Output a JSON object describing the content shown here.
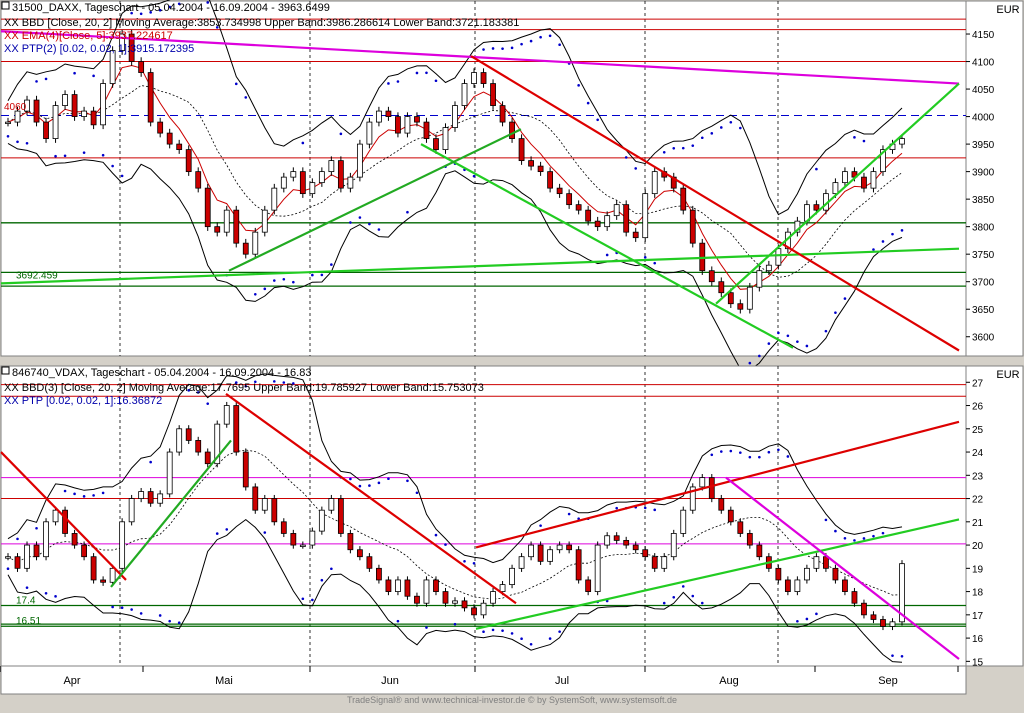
{
  "chart_data": [
    {
      "type": "line",
      "panel": "top",
      "instrument_label": "31500_DAXX, Tageschart - 05.04.2004 - 16.09.2004 - 3963.6499",
      "legend": [
        {
          "text": "XX BBD [Close, 20, 2] Moving Average:3853.734998 Upper Band:3986.286614 Lower Band:3721.183381",
          "color": "#000000"
        },
        {
          "text": "XX EMA(4)[Close, 5]:3937.224617",
          "color": "#cc0000"
        },
        {
          "text": "XX PTP(2) [0.02, 0.02, 1]:3915.172395",
          "color": "#0000aa"
        }
      ],
      "currency": "EUR",
      "ylim": [
        3565,
        4210
      ],
      "y_ticks": [
        "3600",
        "3650",
        "3700",
        "3750",
        "3800",
        "3850",
        "3900",
        "3950",
        "4000",
        "4050",
        "4100",
        "4150"
      ],
      "annotations": [
        "3692.459",
        "4060"
      ],
      "horizontal_levels": [
        {
          "y": 4177,
          "color": "#cc0000"
        },
        {
          "y": 4158,
          "color": "#cc0000"
        },
        {
          "y": 4100,
          "color": "#cc0000"
        },
        {
          "y": 4002,
          "color": "#0000cc",
          "style": "dashed"
        },
        {
          "y": 3925,
          "color": "#cc0000"
        },
        {
          "y": 3807,
          "color": "#006600"
        },
        {
          "y": 3717,
          "color": "#006600"
        },
        {
          "y": 3692,
          "color": "#006600"
        }
      ],
      "trendlines": [
        {
          "x0": 0,
          "y0": 4155,
          "x1": 958,
          "y1": 4060,
          "color": "#dd00dd"
        },
        {
          "x0": 0,
          "y0": 3697,
          "x1": 958,
          "y1": 3760,
          "color": "#22cc22"
        },
        {
          "x0": 470,
          "y0": 4110,
          "x1": 958,
          "y1": 3575,
          "color": "#dd0000"
        },
        {
          "x0": 420,
          "y0": 3950,
          "x1": 792,
          "y1": 3580,
          "color": "#22cc22"
        },
        {
          "x0": 228,
          "y0": 3720,
          "x1": 520,
          "y1": 3977,
          "color": "#22aa22"
        },
        {
          "x0": 715,
          "y0": 3660,
          "x1": 958,
          "y1": 4060,
          "color": "#22cc22"
        }
      ],
      "series": [
        {
          "name": "Close",
          "values": [
            3990,
            4010,
            4030,
            3990,
            3960,
            4020,
            4040,
            4000,
            4010,
            3985,
            4060,
            4120,
            4150,
            4100,
            4080,
            3990,
            3970,
            3950,
            3940,
            3900,
            3870,
            3800,
            3790,
            3830,
            3770,
            3750,
            3790,
            3830,
            3870,
            3890,
            3900,
            3860,
            3880,
            3900,
            3920,
            3870,
            3890,
            3950,
            3990,
            4010,
            4000,
            3970,
            4000,
            3990,
            3960,
            3940,
            3980,
            4020,
            4060,
            4080,
            4060,
            4020,
            3990,
            3960,
            3920,
            3910,
            3900,
            3870,
            3860,
            3840,
            3830,
            3810,
            3800,
            3820,
            3840,
            3790,
            3780,
            3860,
            3900,
            3890,
            3870,
            3830,
            3770,
            3720,
            3700,
            3680,
            3660,
            3650,
            3690,
            3720,
            3730,
            3760,
            3790,
            3810,
            3840,
            3830,
            3860,
            3880,
            3900,
            3890,
            3870,
            3900,
            3940,
            3950,
            3960
          ]
        }
      ]
    },
    {
      "type": "line",
      "panel": "bottom",
      "instrument_label": "846740_VDAX, Tageschart - 05.04.2004 - 16.09.2004 - 16.83",
      "legend": [
        {
          "text": "XX BBD(3) [Close, 20, 2] Moving Average:17.7695 Upper Band:19.785927 Lower Band:15.753073",
          "color": "#000000"
        },
        {
          "text": "XX PTP [0.02, 0.02, 1]:16.36872",
          "color": "#0000aa"
        }
      ],
      "currency": "EUR",
      "ylim": [
        14.8,
        27.7
      ],
      "y_ticks": [
        "15",
        "16",
        "17",
        "18",
        "19",
        "20",
        "21",
        "22",
        "23",
        "24",
        "25",
        "26",
        "27"
      ],
      "annotations": [
        "17.4",
        "16.51"
      ],
      "horizontal_levels": [
        {
          "y": 26.9,
          "color": "#cc0000"
        },
        {
          "y": 26.4,
          "color": "#cc0000"
        },
        {
          "y": 22.0,
          "color": "#cc0000"
        },
        {
          "y": 22.9,
          "color": "#dd00dd"
        },
        {
          "y": 20.05,
          "color": "#dd00dd"
        },
        {
          "y": 17.4,
          "color": "#006600"
        },
        {
          "y": 16.6,
          "color": "#006600"
        },
        {
          "y": 16.51,
          "color": "#006600"
        }
      ],
      "trendlines": [
        {
          "x0": 475,
          "y0": 19.9,
          "x1": 958,
          "y1": 25.3,
          "color": "#dd0000"
        },
        {
          "x0": 475,
          "y0": 16.4,
          "x1": 958,
          "y1": 21.1,
          "color": "#22cc22"
        },
        {
          "x0": 225,
          "y0": 26.5,
          "x1": 515,
          "y1": 17.5,
          "color": "#dd0000"
        },
        {
          "x0": 0,
          "y0": 24.0,
          "x1": 125,
          "y1": 18.5,
          "color": "#dd0000"
        },
        {
          "x0": 110,
          "y0": 18.2,
          "x1": 230,
          "y1": 24.5,
          "color": "#22aa22"
        },
        {
          "x0": 725,
          "y0": 22.9,
          "x1": 958,
          "y1": 15.1,
          "color": "#dd00dd"
        }
      ],
      "series": [
        {
          "name": "Close",
          "values": [
            19.5,
            19.0,
            20.0,
            19.5,
            21.0,
            21.5,
            20.5,
            20.0,
            19.5,
            18.5,
            18.4,
            19.0,
            21.0,
            22.0,
            22.3,
            21.8,
            22.2,
            24.0,
            25.0,
            24.5,
            24.0,
            23.5,
            25.2,
            26.0,
            24.0,
            22.5,
            21.5,
            22.0,
            21.0,
            20.5,
            20.0,
            20.0,
            20.6,
            21.5,
            22.0,
            20.5,
            19.8,
            19.5,
            19.0,
            18.5,
            18.0,
            18.5,
            17.8,
            17.5,
            18.5,
            18.0,
            17.5,
            17.6,
            17.3,
            17.0,
            17.5,
            18.0,
            18.3,
            19.0,
            19.5,
            20.0,
            19.3,
            19.8,
            20.0,
            19.8,
            18.5,
            18.0,
            20.0,
            20.4,
            20.2,
            20.0,
            19.8,
            19.5,
            19.0,
            19.5,
            20.5,
            21.5,
            22.5,
            22.9,
            22.0,
            21.5,
            21.0,
            20.5,
            20.0,
            19.5,
            19.0,
            18.5,
            18.0,
            18.5,
            19.0,
            19.5,
            19.0,
            18.5,
            18.0,
            17.5,
            17.0,
            16.8,
            16.5,
            16.7,
            19.2
          ]
        }
      ]
    }
  ],
  "x_axis": {
    "months": [
      "Apr",
      "Mai",
      "Jun",
      "Jul",
      "Aug",
      "Sep"
    ]
  },
  "footer": "TradeSignal® and www.technical-investor.de © by SystemSoft, www.systemsoft.de"
}
